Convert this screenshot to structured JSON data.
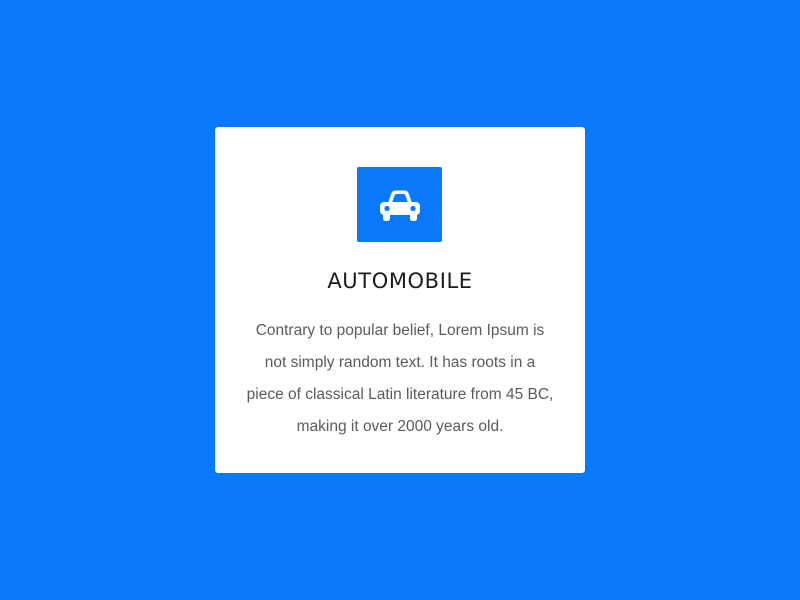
{
  "theme": {
    "background": "#0a78fa",
    "card_background": "#ffffff",
    "accent": "#0a78fa"
  },
  "card": {
    "icon": "car-icon",
    "title": "AUTOMOBILE",
    "description": "Contrary to popular belief, Lorem Ipsum is not simply random text. It has roots in a piece of classical Latin literature from 45 BC, making it over 2000 years old."
  }
}
